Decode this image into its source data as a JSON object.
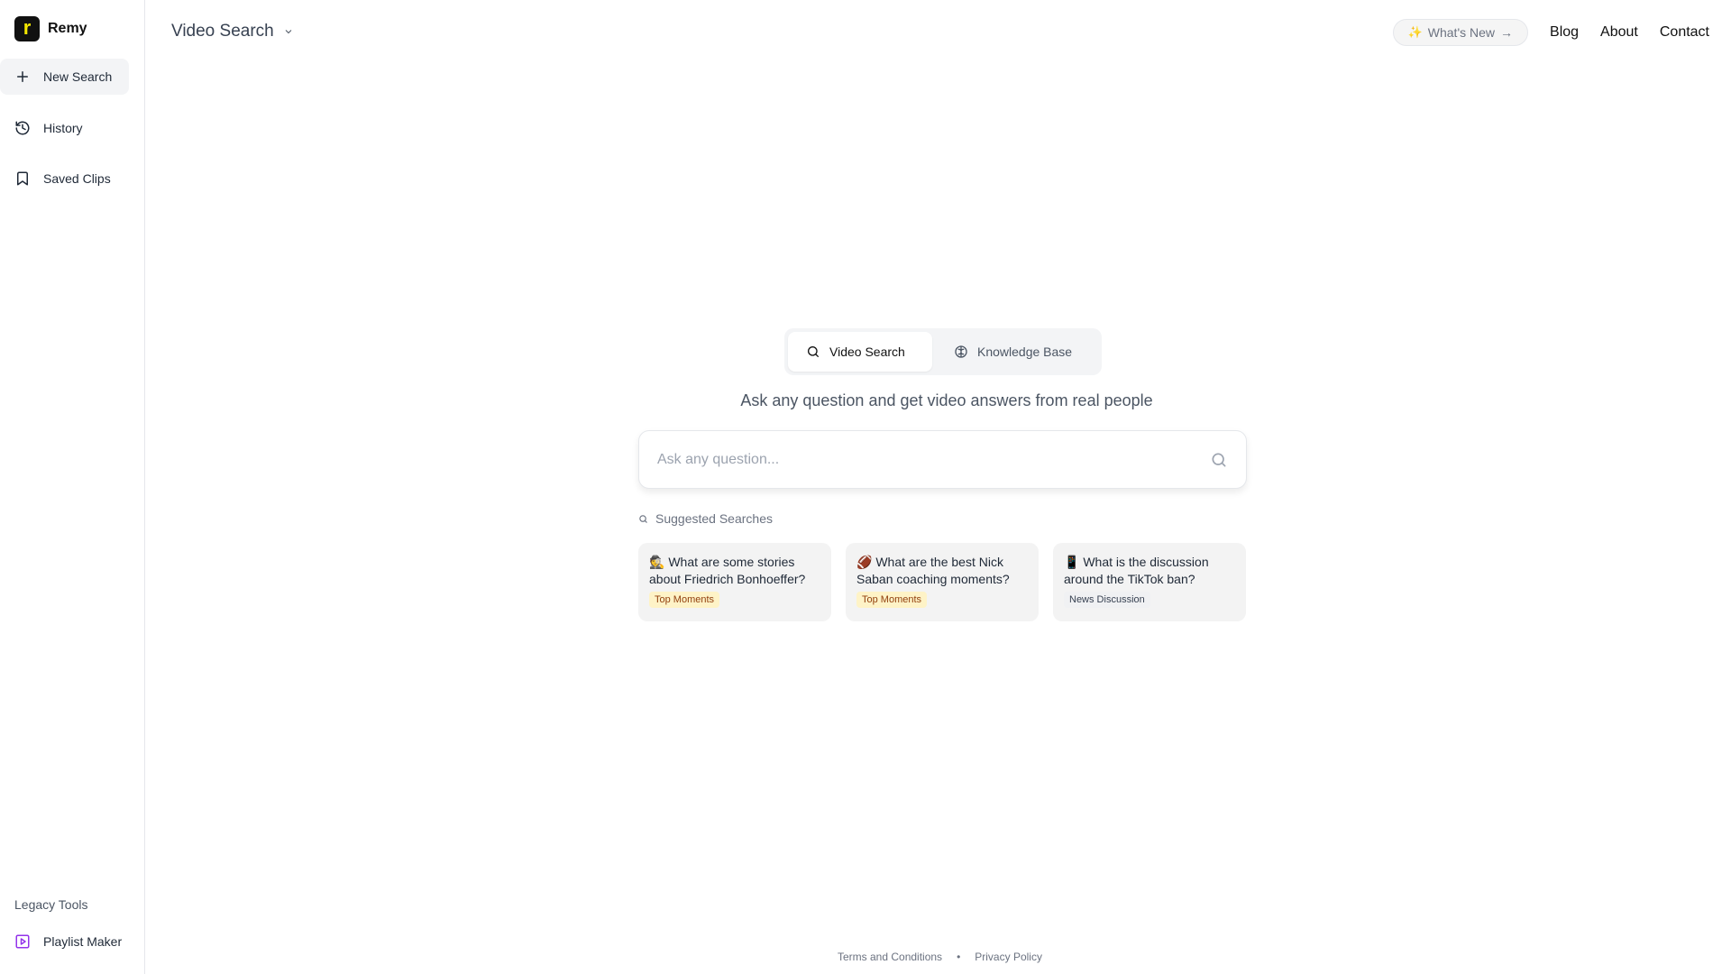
{
  "brand": {
    "name": "Remy",
    "logo_letter": "r"
  },
  "sidebar": {
    "items": [
      {
        "label": "New Search",
        "icon": "plus-icon"
      },
      {
        "label": "History",
        "icon": "history-icon"
      },
      {
        "label": "Saved Clips",
        "icon": "bookmark-icon"
      }
    ],
    "legacy_section_label": "Legacy Tools",
    "legacy_items": [
      {
        "label": "Playlist Maker",
        "icon": "play-square-icon"
      }
    ]
  },
  "header": {
    "title": "Video Search",
    "whats_new": "What's New",
    "whats_new_sparkle": "✨",
    "whats_new_arrow": "→",
    "links": [
      "Blog",
      "About",
      "Contact"
    ]
  },
  "main": {
    "tabs": [
      {
        "label": "Video Search",
        "icon": "search-icon",
        "active": true
      },
      {
        "label": "Knowledge Base",
        "icon": "brain-icon",
        "active": false
      }
    ],
    "tagline": "Ask any question and get video answers from real people",
    "search": {
      "placeholder": "Ask any question...",
      "value": ""
    },
    "suggested_label": "Suggested Searches",
    "suggestions": [
      {
        "emoji": "🕵️",
        "text": "What are some stories about Friedrich Bonhoeffer?",
        "tag": "Top Moments"
      },
      {
        "emoji": "🏈",
        "text": "What are the best Nick Saban coaching moments?",
        "tag": "Top Moments"
      },
      {
        "emoji": "📱",
        "text": "What is the discussion around the TikTok ban?",
        "tag": "News Discussion"
      }
    ]
  },
  "footer": {
    "terms": "Terms and Conditions",
    "separator": "•",
    "privacy": "Privacy Policy"
  },
  "colors": {
    "brand_logo_bg": "#111111",
    "brand_logo_letter": "#f5e800",
    "tag_yellow_bg": "#fef3c7",
    "tag_yellow_text": "#92400e",
    "playlist_icon": "#9333ea"
  }
}
